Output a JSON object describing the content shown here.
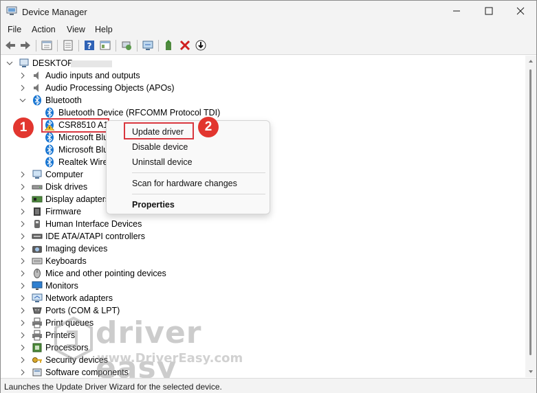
{
  "window": {
    "title": "Device Manager",
    "minimize_icon": "minimize-icon",
    "maximize_icon": "maximize-icon",
    "close_icon": "close-icon"
  },
  "menu": [
    "File",
    "Action",
    "View",
    "Help"
  ],
  "toolbar": {
    "icons": [
      "back-arrow-icon",
      "forward-arrow-icon",
      "properties-sheet-icon",
      "show-hide-console-icon",
      "help-icon",
      "view-details-icon",
      "computer-management-icon",
      "scan-hardware-icon",
      "add-driver-icon",
      "uninstall-red-x-icon",
      "update-driver-down-arrow-icon"
    ]
  },
  "tree": {
    "root": "DESKTOP-",
    "items": [
      {
        "label": "Audio inputs and outputs",
        "icon": "speaker-icon",
        "expanded": false
      },
      {
        "label": "Audio Processing Objects (APOs)",
        "icon": "speaker-icon",
        "expanded": false
      },
      {
        "label": "Bluetooth",
        "icon": "bluetooth-icon",
        "expanded": true,
        "children": [
          {
            "label": "Bluetooth Device (RFCOMM Protocol TDI)",
            "icon": "bluetooth-icon"
          },
          {
            "label": "CSR8510 A10",
            "icon": "bluetooth-warning-icon",
            "selected": true
          },
          {
            "label": "Microsoft Blu",
            "icon": "bluetooth-icon"
          },
          {
            "label": "Microsoft Blu",
            "icon": "bluetooth-icon"
          },
          {
            "label": "Realtek Wirel",
            "icon": "bluetooth-icon"
          }
        ]
      },
      {
        "label": "Computer",
        "icon": "computer-icon",
        "expanded": false
      },
      {
        "label": "Disk drives",
        "icon": "disk-drive-icon",
        "expanded": false
      },
      {
        "label": "Display adapters",
        "icon": "display-adapter-icon",
        "expanded": false
      },
      {
        "label": "Firmware",
        "icon": "firmware-icon",
        "expanded": false
      },
      {
        "label": "Human Interface Devices",
        "icon": "hid-icon",
        "expanded": false
      },
      {
        "label": "IDE ATA/ATAPI controllers",
        "icon": "ide-controller-icon",
        "expanded": false
      },
      {
        "label": "Imaging devices",
        "icon": "camera-icon",
        "expanded": false
      },
      {
        "label": "Keyboards",
        "icon": "keyboard-icon",
        "expanded": false
      },
      {
        "label": "Mice and other pointing devices",
        "icon": "mouse-icon",
        "expanded": false
      },
      {
        "label": "Monitors",
        "icon": "monitor-icon",
        "expanded": false
      },
      {
        "label": "Network adapters",
        "icon": "network-adapter-icon",
        "expanded": false
      },
      {
        "label": "Ports (COM & LPT)",
        "icon": "port-icon",
        "expanded": false
      },
      {
        "label": "Print queues",
        "icon": "printer-icon",
        "expanded": false
      },
      {
        "label": "Printers",
        "icon": "printer-icon",
        "expanded": false
      },
      {
        "label": "Processors",
        "icon": "processor-icon",
        "expanded": false
      },
      {
        "label": "Security devices",
        "icon": "security-key-icon",
        "expanded": false
      },
      {
        "label": "Software components",
        "icon": "software-component-icon",
        "expanded": false
      }
    ]
  },
  "context_menu": {
    "items": [
      "Update driver",
      "Disable device",
      "Uninstall device",
      "Scan for hardware changes",
      "Properties"
    ]
  },
  "annotations": {
    "step1": "1",
    "step2": "2",
    "highlight_color": "#d9363e"
  },
  "watermark": {
    "brand": "driver easy",
    "url": "www.DriverEasy.com"
  },
  "status": "Launches the Update Driver Wizard for the selected device.",
  "colors": {
    "chrome": "#f3f3f3",
    "accent_blue": "#1976d2",
    "badge_red": "#e2362f"
  }
}
